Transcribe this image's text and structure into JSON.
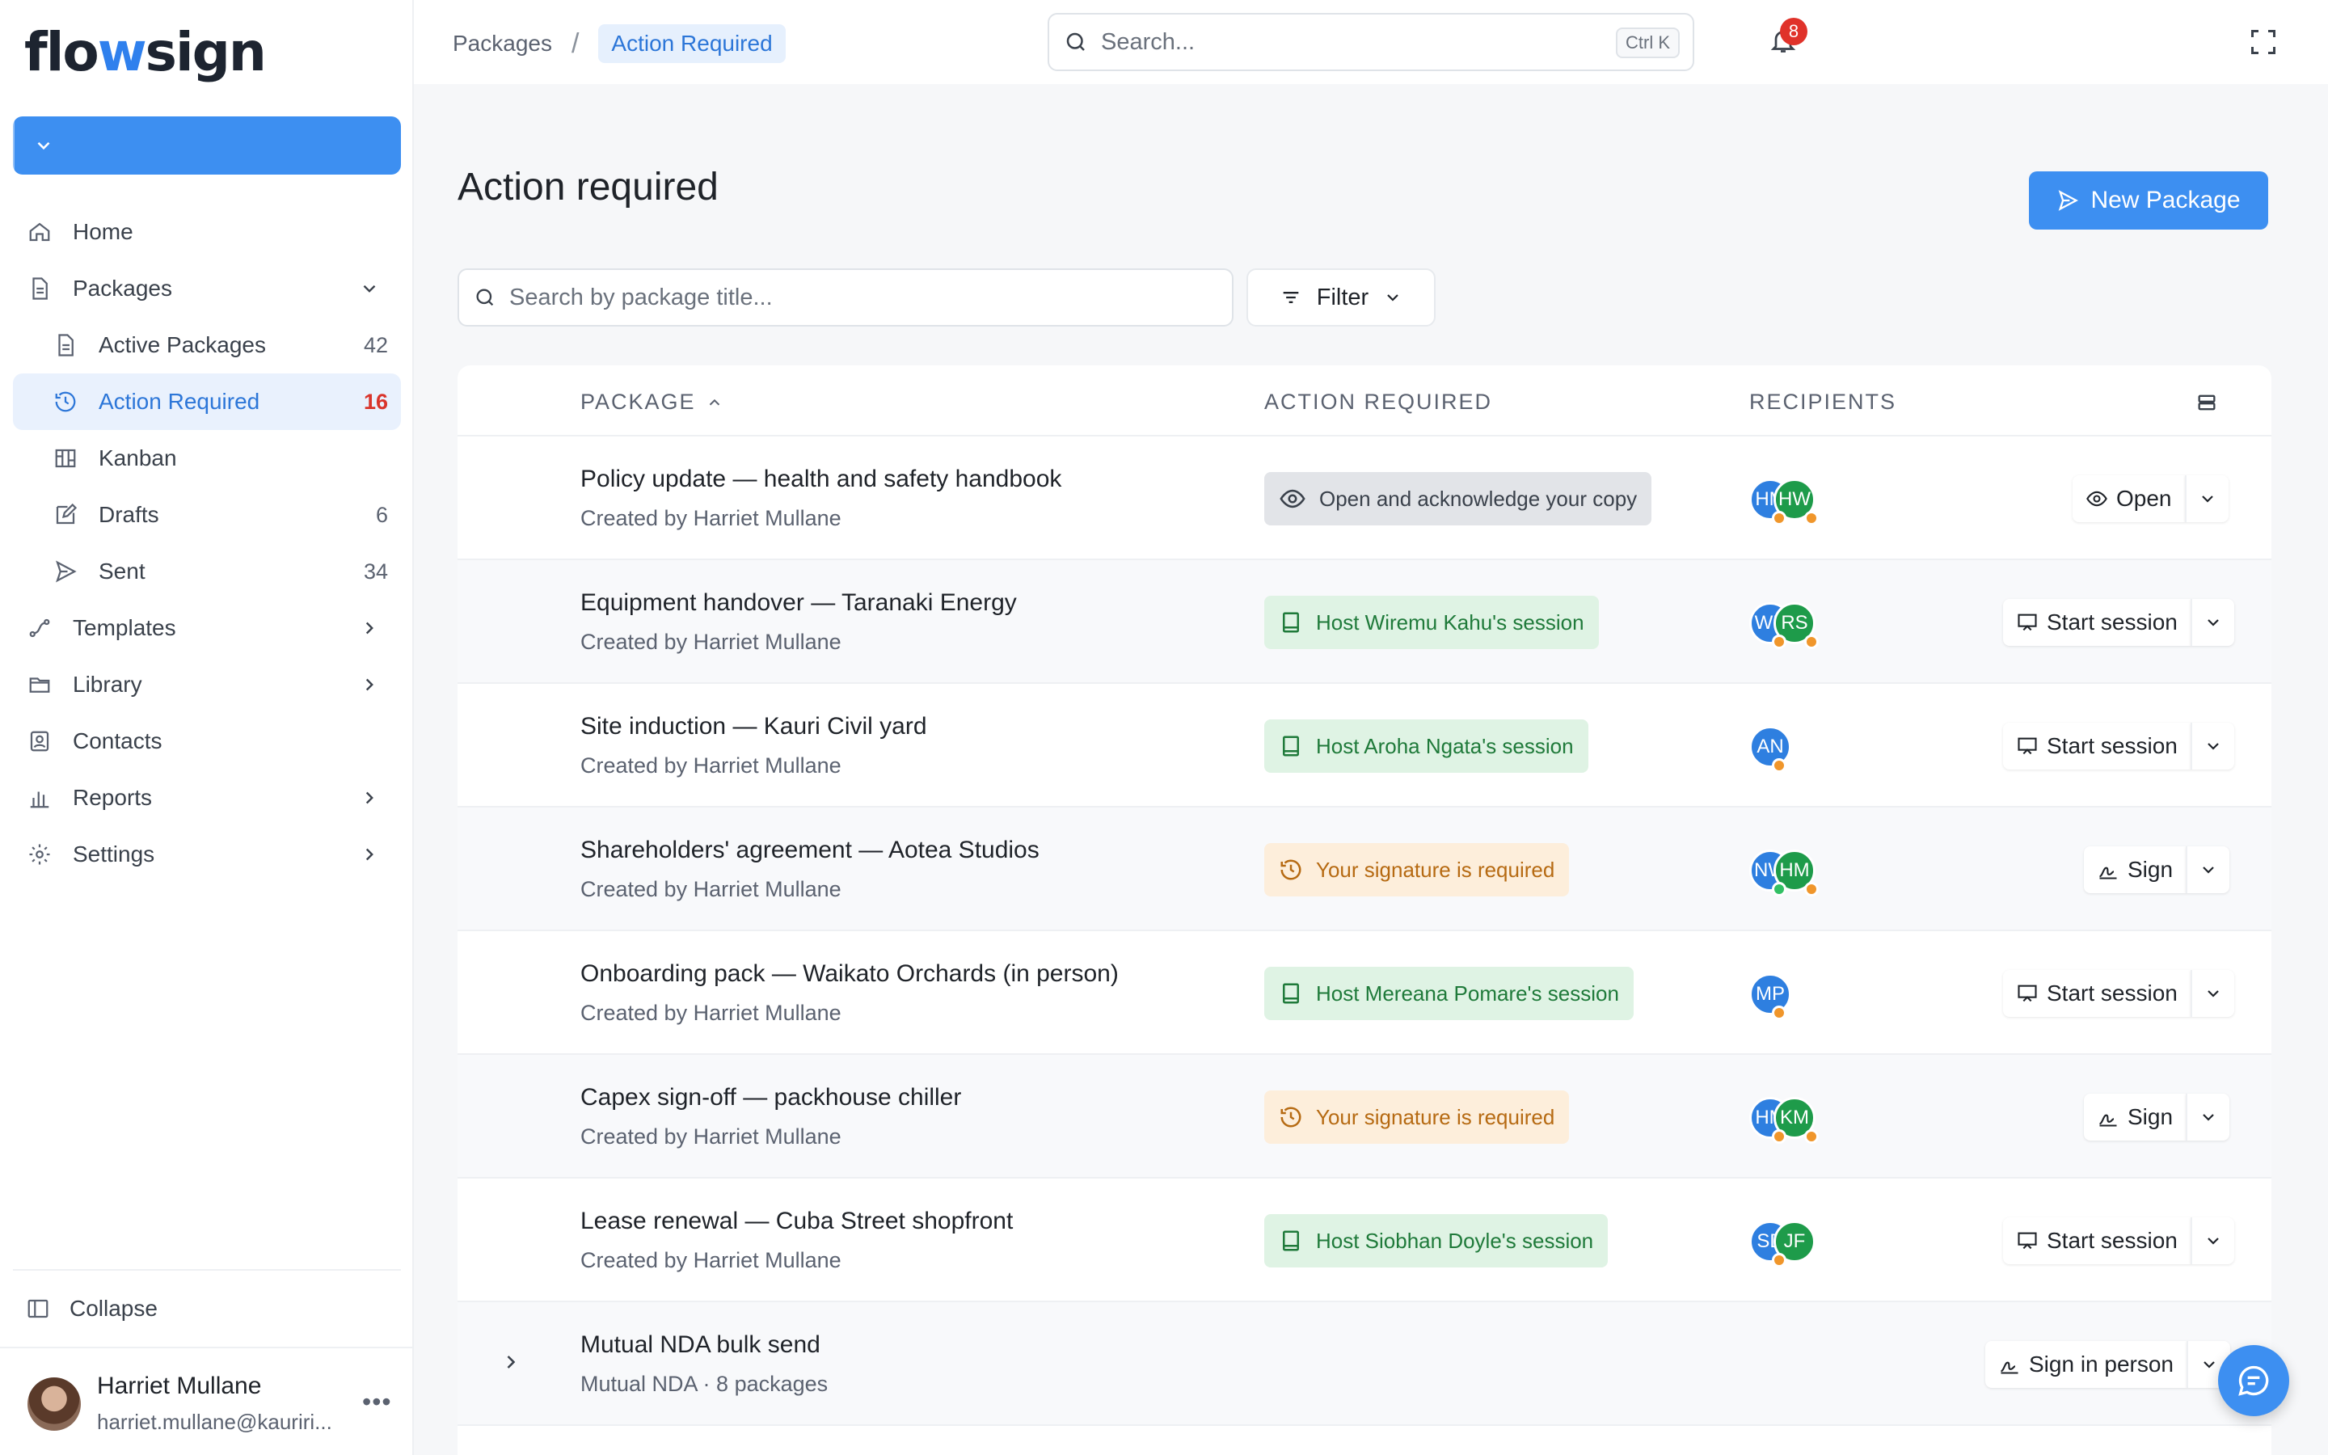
{
  "app": {
    "logo_pre": "flo",
    "logo_w": "w",
    "logo_post": "sign",
    "new_package": "New Package"
  },
  "sidebar": {
    "items": [
      {
        "label": "Home",
        "icon": "home-icon"
      },
      {
        "label": "Packages",
        "icon": "document-icon",
        "expanded": true
      },
      {
        "label": "Active Packages",
        "count": "42",
        "icon": "document-icon"
      },
      {
        "label": "Action Required",
        "count": "16",
        "icon": "history-icon",
        "active": true
      },
      {
        "label": "Kanban",
        "icon": "kanban-icon"
      },
      {
        "label": "Drafts",
        "count": "6",
        "icon": "edit-icon"
      },
      {
        "label": "Sent",
        "count": "34",
        "icon": "send-icon"
      },
      {
        "label": "Templates",
        "icon": "template-icon"
      },
      {
        "label": "Library",
        "icon": "folder-icon"
      },
      {
        "label": "Contacts",
        "icon": "contacts-icon"
      },
      {
        "label": "Reports",
        "icon": "chart-icon"
      },
      {
        "label": "Settings",
        "icon": "gear-icon"
      }
    ],
    "collapse": "Collapse",
    "user": {
      "name": "Harriet Mullane",
      "email": "harriet.mullane@kauriri...",
      "more": "•••"
    }
  },
  "topbar": {
    "breadcrumb": [
      "Packages",
      "Action Required"
    ],
    "search_placeholder": "Search...",
    "search_shortcut": "Ctrl K",
    "notifications": "8"
  },
  "main": {
    "title": "Action required",
    "new_package": "New Package",
    "search_placeholder": "Search by package title...",
    "filter": "Filter",
    "columns": {
      "package": "PACKAGE",
      "action": "ACTION REQUIRED",
      "recipients": "RECIPIENTS"
    },
    "rows": [
      {
        "title": "Policy update — health and safety handbook",
        "sub": "Created by Harriet Mullane",
        "action": "Open and acknowledge your copy",
        "action_type": "gray",
        "recipients": [
          "HM",
          "HW"
        ],
        "button": "Open"
      },
      {
        "title": "Equipment handover — Taranaki Energy",
        "sub": "Created by Harriet Mullane",
        "action": "Host Wiremu Kahu's session",
        "action_type": "green",
        "recipients": [
          "WK",
          "RS"
        ],
        "button": "Start session"
      },
      {
        "title": "Site induction — Kauri Civil yard",
        "sub": "Created by Harriet Mullane",
        "action": "Host Aroha Ngata's session",
        "action_type": "green",
        "recipients": [
          "AN"
        ],
        "button": "Start session"
      },
      {
        "title": "Shareholders' agreement — Aotea Studios",
        "sub": "Created by Harriet Mullane",
        "action": "Your signature is required",
        "action_type": "amber",
        "recipients": [
          "NW",
          "HM"
        ],
        "button": "Sign"
      },
      {
        "title": "Onboarding pack — Waikato Orchards (in person)",
        "sub": "Created by Harriet Mullane",
        "action": "Host Mereana Pomare's session",
        "action_type": "green",
        "recipients": [
          "MP"
        ],
        "button": "Start session"
      },
      {
        "title": "Capex sign-off — packhouse chiller",
        "sub": "Created by Harriet Mullane",
        "action": "Your signature is required",
        "action_type": "amber",
        "recipients": [
          "HM",
          "KM"
        ],
        "button": "Sign"
      },
      {
        "title": "Lease renewal — Cuba Street shopfront",
        "sub": "Created by Harriet Mullane",
        "action": "Host Siobhan Doyle's session",
        "action_type": "green",
        "recipients": [
          "SD",
          "JF"
        ],
        "button": "Start session"
      },
      {
        "title": "Mutual NDA bulk send",
        "sub": "Mutual NDA · 8 packages",
        "button": "Sign in person"
      }
    ]
  },
  "colors": {
    "accent": "#3d8ff1",
    "active_bg": "#e9f1fd",
    "danger": "#e0322a"
  }
}
